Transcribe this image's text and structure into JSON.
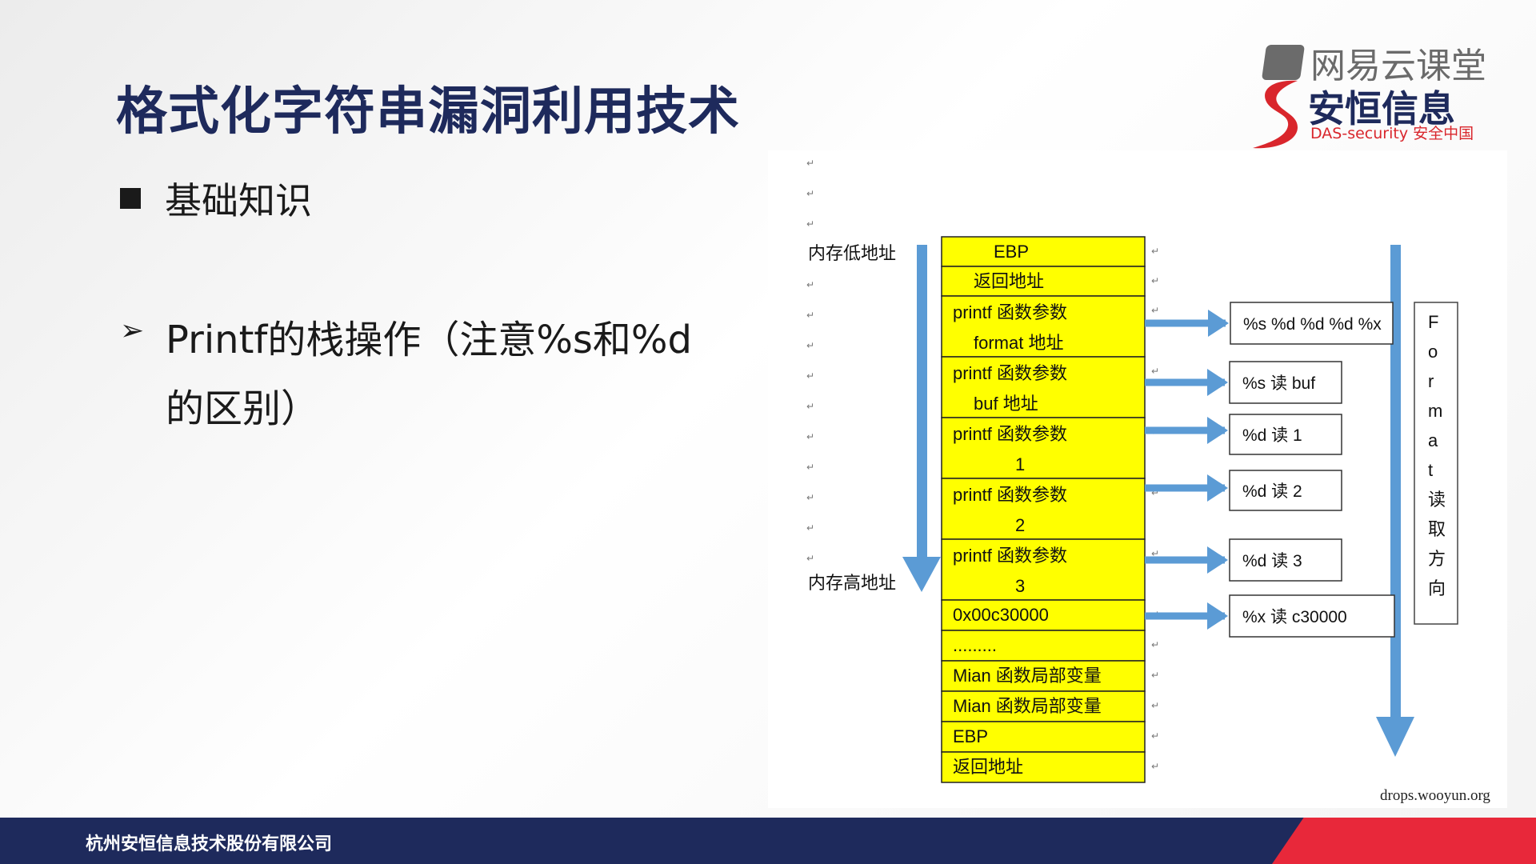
{
  "slide": {
    "title": "格式化字符串漏洞利用技术",
    "bullet": "基础知识",
    "sub_line1": "Printf的栈操作（注意%s和%d",
    "sub_line2": "的区别）"
  },
  "logo": {
    "netease_text": "网易云课堂",
    "brand_text": "安恒信息",
    "das_text": "DAS-security 安全中国"
  },
  "diagram": {
    "low_address_label": "内存低地址",
    "high_address_label": "内存高地址",
    "stack_cells": [
      {
        "line1": "EBP",
        "line2": ""
      },
      {
        "line1": "返回地址",
        "line2": ""
      },
      {
        "line1": "printf 函数参数",
        "line2": "format 地址"
      },
      {
        "line1": "printf 函数参数",
        "line2": "buf 地址"
      },
      {
        "line1": "printf 函数参数",
        "line2": "1"
      },
      {
        "line1": "printf 函数参数",
        "line2": "2"
      },
      {
        "line1": "printf 函数参数",
        "line2": "3"
      },
      {
        "line1": "0x00c30000",
        "line2": ""
      },
      {
        "line1": ".........",
        "line2": ""
      },
      {
        "line1": "Mian 函数局部变量",
        "line2": ""
      },
      {
        "line1": "Mian 函数局部变量",
        "line2": ""
      },
      {
        "line1": "EBP",
        "line2": ""
      },
      {
        "line1": "返回地址",
        "line2": ""
      }
    ],
    "format_boxes": [
      "%s %d %d %d %x",
      "%s 读 buf",
      "%d  读 1",
      "%d  读 2",
      "%d  读 3",
      "%x  读 c30000"
    ],
    "format_direction_chars": [
      "F",
      "o",
      "r",
      "m",
      "a",
      "t",
      "读",
      "取",
      "方",
      "向"
    ],
    "source": "drops.wooyun.org",
    "colors": {
      "cell_fill": "#ffff00",
      "arrow": "#5b9bd5"
    }
  },
  "footer": {
    "company": "杭州安恒信息技术股份有限公司"
  }
}
